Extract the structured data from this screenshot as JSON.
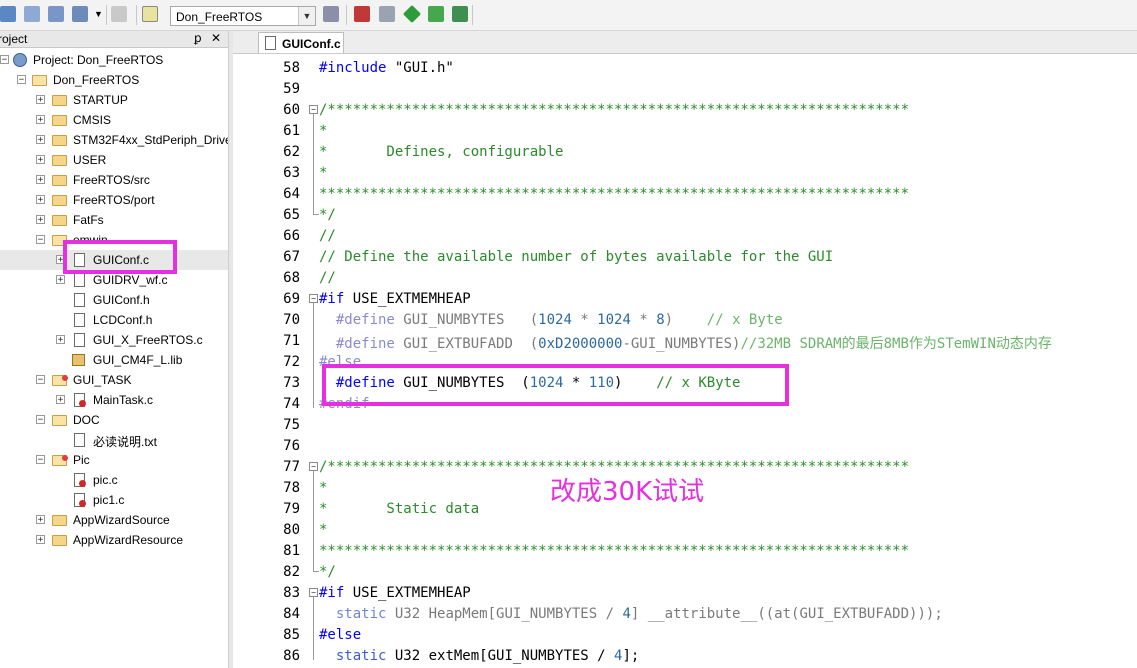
{
  "toolbar": {
    "target_name": "Don_FreeRTOS",
    "icons": [
      "batch-build-icon",
      "rebuild-icon",
      "build-icon",
      "dropdown-arrow-icon",
      "options-icon",
      "load-icon",
      "wand-icon",
      "manage-components-icon",
      "file-extensions-icon",
      "select-packs-icon",
      "pack-installer-icon",
      "event-recorder-icon"
    ]
  },
  "project_pane": {
    "title": "roject",
    "pin_glyph": "ꝑ",
    "close_glyph": "✕",
    "root_label": "Project: Don_FreeRTOS",
    "target_label": "Don_FreeRTOS",
    "groups": [
      {
        "label": "STARTUP"
      },
      {
        "label": "CMSIS"
      },
      {
        "label": "STM32F4xx_StdPeriph_Driver"
      },
      {
        "label": "USER"
      },
      {
        "label": "FreeRTOS/src"
      },
      {
        "label": "FreeRTOS/port"
      },
      {
        "label": "FatFs"
      },
      {
        "label": "emwin"
      }
    ],
    "emwin_files": [
      {
        "label": "GUIConf.c"
      },
      {
        "label": "GUIDRV_wf.c"
      },
      {
        "label": "GUIConf.h"
      },
      {
        "label": "LCDConf.h"
      },
      {
        "label": "GUI_X_FreeRTOS.c"
      },
      {
        "label": "GUI_CM4F_L.lib"
      }
    ],
    "gui_task": {
      "label": "GUI_TASK",
      "files": [
        "MainTask.c"
      ]
    },
    "doc": {
      "label": "DOC",
      "files": [
        "必读说明.txt"
      ]
    },
    "pic": {
      "label": "Pic",
      "files": [
        "pic.c",
        "pic1.c"
      ]
    },
    "tail_groups": [
      "AppWizardSource",
      "AppWizardResource"
    ]
  },
  "editor": {
    "tab_label": "GUIConf.c",
    "lines": [
      {
        "n": "58",
        "fold": "",
        "segs": [
          [
            "pp",
            "#include "
          ],
          [
            "",
            "\"GUI.h\""
          ]
        ]
      },
      {
        "n": "59",
        "fold": "",
        "segs": []
      },
      {
        "n": "60",
        "fold": "open",
        "segs": [
          [
            "com",
            "/*********************************************************************"
          ]
        ]
      },
      {
        "n": "61",
        "fold": "",
        "segs": [
          [
            "com",
            "*"
          ]
        ]
      },
      {
        "n": "62",
        "fold": "",
        "segs": [
          [
            "com",
            "*       Defines, configurable"
          ]
        ]
      },
      {
        "n": "63",
        "fold": "",
        "segs": [
          [
            "com",
            "*"
          ]
        ]
      },
      {
        "n": "64",
        "fold": "",
        "segs": [
          [
            "com",
            "**********************************************************************"
          ]
        ]
      },
      {
        "n": "65",
        "fold": "end",
        "segs": [
          [
            "com",
            "*/"
          ]
        ]
      },
      {
        "n": "66",
        "fold": "",
        "segs": [
          [
            "com",
            "//"
          ]
        ]
      },
      {
        "n": "67",
        "fold": "",
        "segs": [
          [
            "com",
            "// Define the available number of bytes available for the GUI"
          ]
        ]
      },
      {
        "n": "68",
        "fold": "",
        "segs": [
          [
            "com",
            "//"
          ]
        ]
      },
      {
        "n": "69",
        "fold": "open",
        "segs": [
          [
            "pp",
            "#if "
          ],
          [
            "",
            "USE_EXTMEMHEAP"
          ]
        ]
      },
      {
        "n": "70",
        "fold": "",
        "segs": [
          [
            "",
            "  "
          ],
          [
            "ppdim",
            "#define "
          ],
          [
            "dim",
            "GUI_NUMBYTES   ("
          ],
          [
            "num",
            "1024"
          ],
          [
            "dim",
            " * "
          ],
          [
            "num",
            "1024"
          ],
          [
            "dim",
            " * "
          ],
          [
            "num",
            "8"
          ],
          [
            "dim",
            ")    "
          ],
          [
            "comdim",
            "// x Byte"
          ]
        ]
      },
      {
        "n": "71",
        "fold": "",
        "segs": [
          [
            "",
            "  "
          ],
          [
            "ppdim",
            "#define "
          ],
          [
            "dim",
            "GUI_EXTBUFADD  ("
          ],
          [
            "num",
            "0xD2000000"
          ],
          [
            "dim",
            "-GUI_NUMBYTES)"
          ],
          [
            "comdim",
            "//32MB SDRAM的最后8MB作为STemWIN动态内存"
          ]
        ]
      },
      {
        "n": "72",
        "fold": "",
        "segs": [
          [
            "ppdim",
            "#else"
          ]
        ]
      },
      {
        "n": "73",
        "fold": "",
        "segs": [
          [
            "",
            "  "
          ],
          [
            "pp",
            "#define "
          ],
          [
            "",
            "GUI_NUMBYTES  ("
          ],
          [
            "num",
            "1024"
          ],
          [
            "",
            " * "
          ],
          [
            "num",
            "110"
          ],
          [
            "",
            ")    "
          ],
          [
            "com",
            "// x KByte"
          ]
        ]
      },
      {
        "n": "74",
        "fold": "",
        "segs": [
          [
            "ppdim",
            "#endif"
          ]
        ]
      },
      {
        "n": "75",
        "fold": "",
        "segs": []
      },
      {
        "n": "76",
        "fold": "",
        "segs": []
      },
      {
        "n": "77",
        "fold": "open",
        "segs": [
          [
            "com",
            "/*********************************************************************"
          ]
        ]
      },
      {
        "n": "78",
        "fold": "",
        "segs": [
          [
            "com",
            "*"
          ]
        ]
      },
      {
        "n": "79",
        "fold": "",
        "segs": [
          [
            "com",
            "*       Static data"
          ]
        ]
      },
      {
        "n": "80",
        "fold": "",
        "segs": [
          [
            "com",
            "*"
          ]
        ]
      },
      {
        "n": "81",
        "fold": "",
        "segs": [
          [
            "com",
            "**********************************************************************"
          ]
        ]
      },
      {
        "n": "82",
        "fold": "end",
        "segs": [
          [
            "com",
            "*/"
          ]
        ]
      },
      {
        "n": "83",
        "fold": "open",
        "segs": [
          [
            "pp",
            "#if "
          ],
          [
            "",
            "USE_EXTMEMHEAP"
          ]
        ]
      },
      {
        "n": "84",
        "fold": "",
        "segs": [
          [
            "",
            "  "
          ],
          [
            "kwdim",
            "static "
          ],
          [
            "dim",
            "U32 HeapMem[GUI_NUMBYTES / "
          ],
          [
            "num",
            "4"
          ],
          [
            "dim",
            "] __attribute__((at(GUI_EXTBUFADD)));"
          ]
        ]
      },
      {
        "n": "85",
        "fold": "",
        "segs": [
          [
            "pp",
            "#else"
          ]
        ]
      },
      {
        "n": "86",
        "fold": "",
        "segs": [
          [
            "",
            "  "
          ],
          [
            "kw",
            "static "
          ],
          [
            "",
            "U32 extMem[GUI_NUMBYTES / "
          ],
          [
            "num",
            "4"
          ],
          [
            "",
            "];"
          ]
        ]
      }
    ]
  },
  "annotation": {
    "text": "改成30K试试",
    "color": "#e52fe0"
  },
  "colors": {
    "preprocessor": "#0000ff",
    "comment": "#2b8a2b",
    "number": "#2c6a9e",
    "keyword": "#3a5fcd",
    "highlight_box": "#e52fe0"
  }
}
